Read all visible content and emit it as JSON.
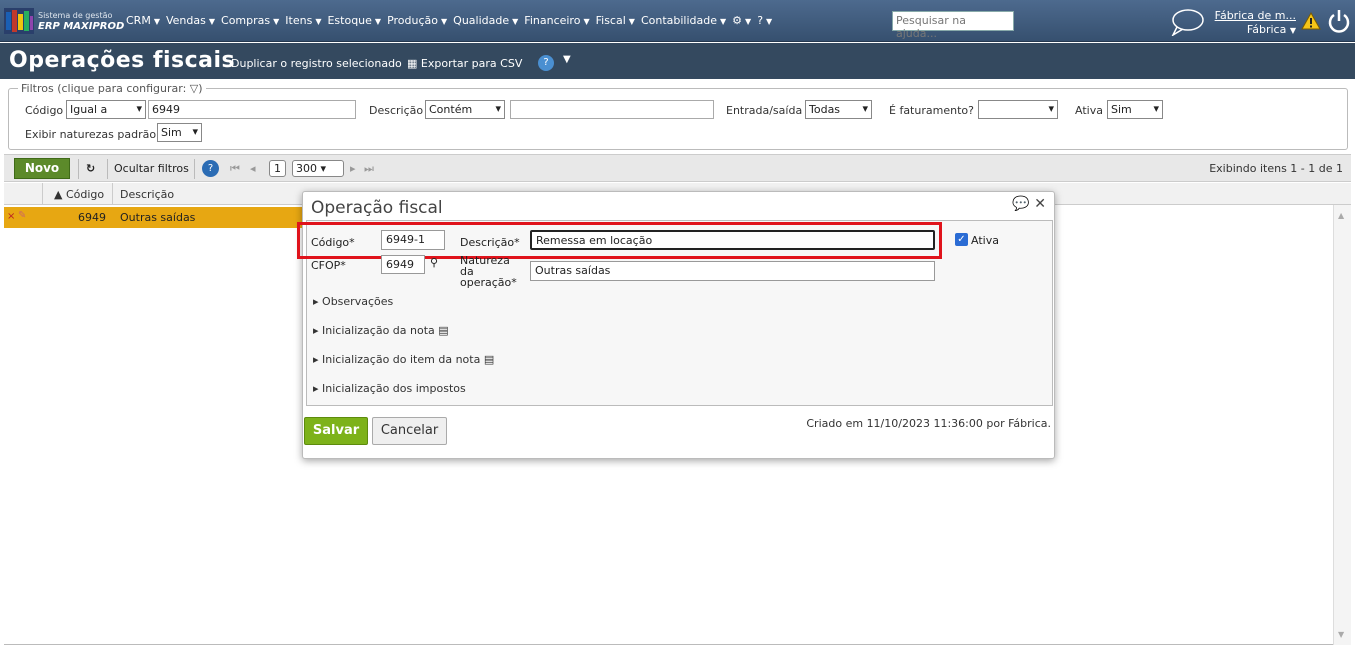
{
  "topbar": {
    "brand_line1": "Sistema de gestão",
    "brand_line2": "ERP MAXIPROD",
    "menu": [
      "CRM",
      "Vendas",
      "Compras",
      "Itens",
      "Estoque",
      "Produção",
      "Qualidade",
      "Financeiro",
      "Fiscal",
      "Contabilidade"
    ],
    "help_placeholder": "Pesquisar na ajuda...",
    "user_line1": "Fábrica de m...",
    "user_line2": "Fábrica"
  },
  "page": {
    "title": "Operações fiscais",
    "action_duplicate": "Duplicar o registro selecionado",
    "action_export": "Exportar para CSV"
  },
  "filters": {
    "legend": "Filtros (clique para configurar:",
    "codigo_label": "Código",
    "codigo_op": "Igual a",
    "codigo_value": "6949",
    "descricao_label": "Descrição",
    "descricao_op": "Contém",
    "descricao_value": "",
    "entrada_label": "Entrada/saída",
    "entrada_value": "Todas",
    "fat_label": "É faturamento?",
    "fat_value": "",
    "ativa_label": "Ativa",
    "ativa_value": "Sim",
    "naturezas_label": "Exibir naturezas padrão",
    "naturezas_value": "Sim"
  },
  "toolbar": {
    "novo": "Novo",
    "ocultar": "Ocultar filtros",
    "page": "1",
    "per_page": "300",
    "showing": "Exibindo itens 1 - 1 de 1"
  },
  "grid": {
    "col_codigo": "Código",
    "col_descricao": "Descrição",
    "row": {
      "codigo": "6949",
      "descricao": "Outras saídas"
    }
  },
  "dialog": {
    "title": "Operação fiscal",
    "codigo_label": "Código*",
    "codigo_value": "6949-1",
    "descricao_label": "Descrição*",
    "descricao_value": "Remessa em locação",
    "ativa_label": "Ativa",
    "cfop_label": "CFOP*",
    "cfop_value": "6949",
    "natureza_label_1": "Natureza",
    "natureza_label_2": "da",
    "natureza_label_3": "operação*",
    "natureza_value": "Outras saídas",
    "sections": [
      "Observações",
      "Inicialização da nota",
      "Inicialização do item da nota",
      "Inicialização dos impostos"
    ],
    "salvar": "Salvar",
    "cancelar": "Cancelar",
    "created": "Criado em 11/10/2023 11:36:00 por Fábrica."
  }
}
